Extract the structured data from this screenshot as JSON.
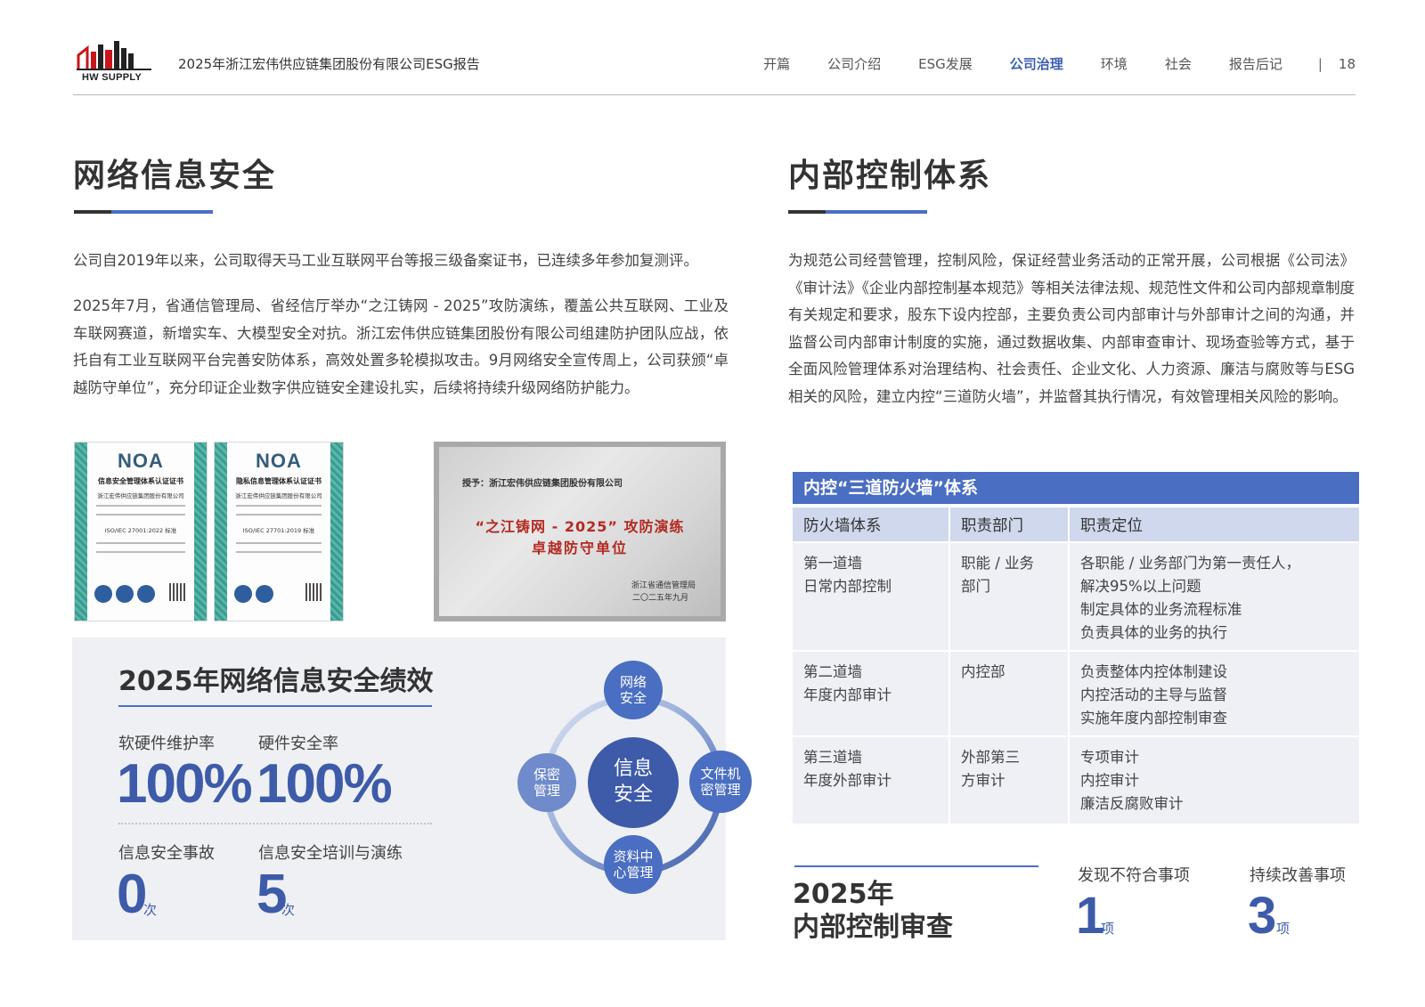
{
  "header": {
    "logo_text": "HW SUPPLY",
    "report_title": "2025年浙江宏伟供应链集团股份有限公司ESG报告",
    "nav": [
      "开篇",
      "公司介绍",
      "ESG发展",
      "公司治理",
      "环境",
      "社会",
      "报告后记"
    ],
    "nav_active": "公司治理",
    "separator": "|",
    "page_number": "18"
  },
  "left": {
    "title": "网络信息安全",
    "para1": "公司自2019年以来，公司取得天马工业互联网平台等报三级备案证书，已连续多年参加复测评。",
    "para2": "2025年7月，省通信管理局、省经信厅举办“之江铸网 - 2025”攻防演练，覆盖公共互联网、工业及车联网赛道，新增实车、大模型安全对抗。浙江宏伟供应链集团股份有限公司组建防护团队应战，依托自有工业互联网平台完善安防体系，高效处置多轮模拟攻击。9月网络安全宣传周上，公司获颁“卓越防守单位”，充分印证企业数字供应链安全建设扎实，后续将持续升级网络防护能力。",
    "certs": [
      {
        "logo": "NOA",
        "name": "信息安全管理体系认证证书",
        "company": "浙江宏伟供应链集团股份有限公司",
        "standard": "ISO/IEC 27001:2022 标准"
      },
      {
        "logo": "NOA",
        "name": "隐私信息管理体系认证证书",
        "company": "浙江宏伟供应链集团股份有限公司",
        "standard": "ISO/IEC 27701:2019 标准"
      }
    ],
    "plaque": {
      "to": "授予：浙江宏伟供应链集团股份有限公司",
      "line1": "“之江铸网 - 2025” 攻防演练",
      "line2": "卓越防守单位",
      "org": "浙江省通信管理局",
      "date": "二〇二五年九月"
    },
    "performance": {
      "title": "2025年网络信息安全绩效",
      "metrics": [
        {
          "label": "软硬件维护率",
          "value": "100%",
          "unit": ""
        },
        {
          "label": "硬件安全率",
          "value": "100%",
          "unit": ""
        },
        {
          "label": "信息安全事故",
          "value": "0",
          "unit": "次"
        },
        {
          "label": "信息安全培训与演练",
          "value": "5",
          "unit": "次"
        }
      ],
      "diagram": {
        "center": "信息\n安全",
        "top": "网络\n安全",
        "right": "文件机\n密管理",
        "bottom": "资料中\n心管理",
        "left": "保密\n管理"
      }
    }
  },
  "right": {
    "title": "内部控制体系",
    "para": "为规范公司经营管理，控制风险，保证经营业务活动的正常开展，公司根据《公司法》《审计法》《企业内部控制基本规范》等相关法律法规、规范性文件和公司内部规章制度有关规定和要求，股东下设内控部，主要负责公司内部审计与外部审计之间的沟通，并监督公司内部审计制度的实施，通过数据收集、内部审查审计、现场查验等方式，基于全面风险管理体系对治理结构、社会责任、企业文化、人力资源、廉洁与腐败等与ESG相关的风险，建立内控“三道防火墙”，并监督其执行情况，有效管理相关风险的影响。",
    "table": {
      "caption": "内控“三道防火墙”体系",
      "headers": [
        "防火墙体系",
        "职责部门",
        "职责定位"
      ],
      "rows": [
        {
          "system": [
            "第一道墙",
            "日常内部控制"
          ],
          "dept": [
            "职能 / 业务",
            "部门"
          ],
          "role": [
            "各职能 / 业务部门为第一责任人，",
            "解决95%以上问题",
            "制定具体的业务流程标准",
            "负责具体的业务的执行"
          ]
        },
        {
          "system": [
            "第二道墙",
            "年度内部审计"
          ],
          "dept": [
            "内控部"
          ],
          "role": [
            "负责整体内控体制建设",
            "内控活动的主导与监督",
            "实施年度内部控制审查"
          ]
        },
        {
          "system": [
            "第三道墙",
            "年度外部审计"
          ],
          "dept": [
            "外部第三",
            "方审计"
          ],
          "role": [
            "专项审计",
            "内控审计",
            "廉洁反腐败审计"
          ]
        }
      ]
    },
    "audit": {
      "title_line1": "2025年",
      "title_line2": "内部控制审查",
      "metrics": [
        {
          "label": "发现不符合事项",
          "value": "1",
          "unit": "项"
        },
        {
          "label": "持续改善事项",
          "value": "3",
          "unit": "项"
        }
      ]
    }
  }
}
